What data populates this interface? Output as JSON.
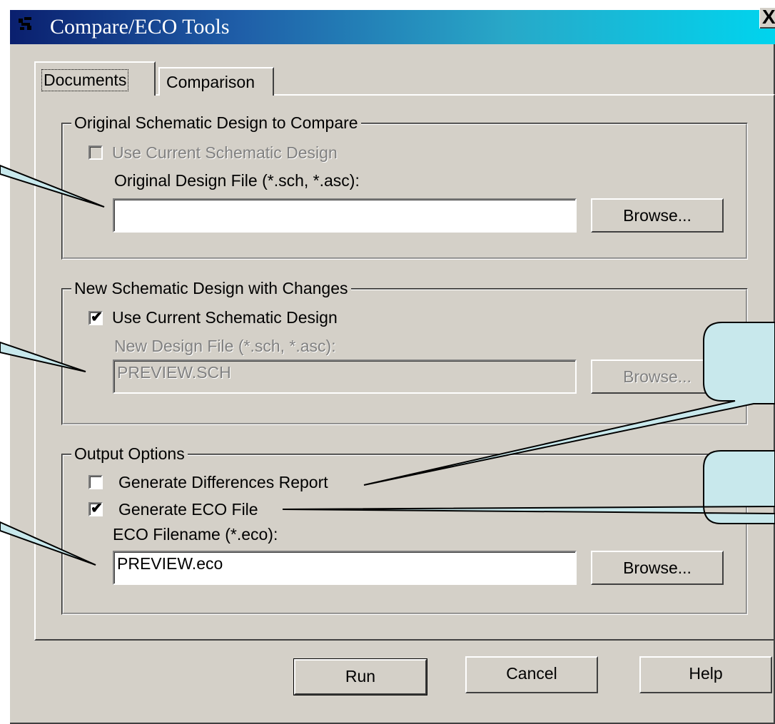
{
  "window": {
    "title": "Compare/ECO Tools",
    "close_glyph": "✕",
    "close_label": "X"
  },
  "tabs": [
    {
      "label": "Documents",
      "active": true
    },
    {
      "label": "Comparison",
      "active": false
    }
  ],
  "original_group": {
    "title": "Original Schematic Design to Compare",
    "use_current_label": "Use Current Schematic Design",
    "use_current_checked": false,
    "use_current_enabled": false,
    "file_label": "Original Design File (*.sch, *.asc):",
    "file_value": "",
    "browse_label": "Browse..."
  },
  "new_group": {
    "title": "New Schematic Design with Changes",
    "use_current_label": "Use Current Schematic Design",
    "use_current_checked": true,
    "file_label": "New Design File (*.sch, *.asc):",
    "file_value": "PREVIEW.SCH",
    "file_enabled": false,
    "browse_label": "Browse..."
  },
  "output_group": {
    "title": "Output Options",
    "diff_report_label": "Generate Differences Report",
    "diff_report_checked": false,
    "eco_file_label": "Generate ECO File",
    "eco_file_checked": true,
    "eco_filename_label": "ECO Filename (*.eco):",
    "eco_filename_value": "PREVIEW.eco",
    "browse_label": "Browse..."
  },
  "buttons": {
    "run": "Run",
    "cancel": "Cancel",
    "help": "Help"
  },
  "colors": {
    "face": "#d4d0c8",
    "callout_fill": "#c8e8ec",
    "title_start": "#0a1f6e",
    "title_end": "#00d4ee"
  },
  "icons": {
    "title_icon": "app-icon",
    "check": "checkmark-icon"
  }
}
